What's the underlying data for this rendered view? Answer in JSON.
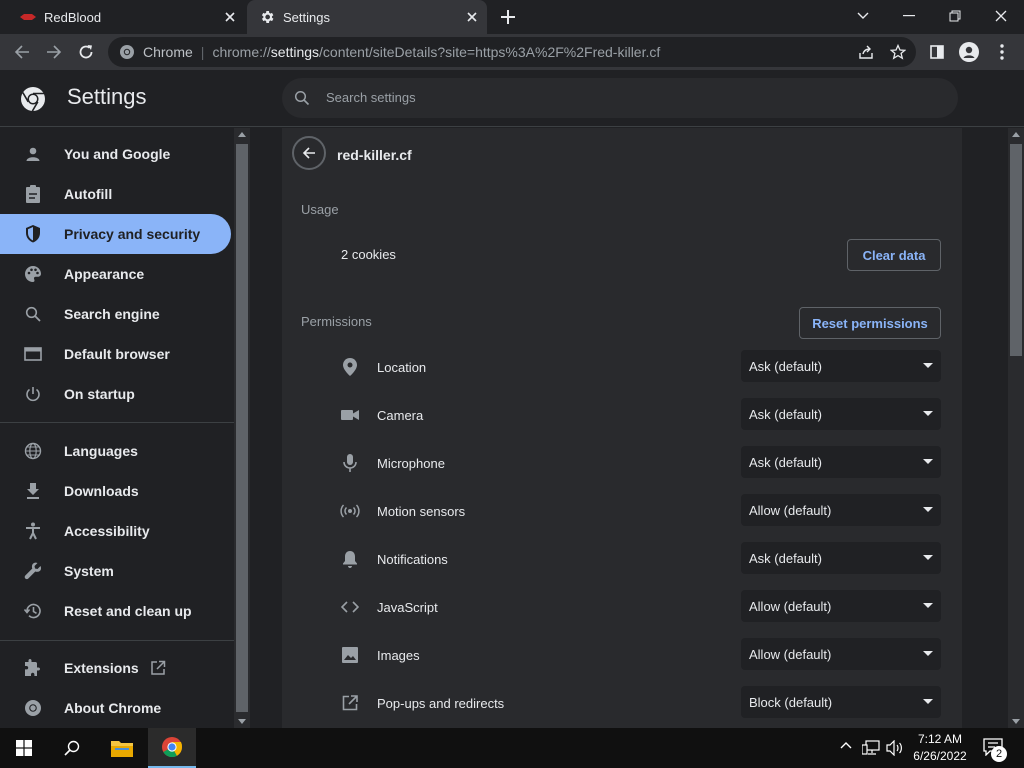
{
  "tabs": [
    {
      "title": "RedBlood",
      "icon": "redblood-favicon"
    },
    {
      "title": "Settings",
      "icon": "gear-icon"
    }
  ],
  "omnibox": {
    "chip": "Chrome",
    "url_prefix": "chrome://",
    "url_host": "settings",
    "url_rest": "/content/siteDetails?site=https%3A%2F%2Fred-killer.cf"
  },
  "header": {
    "title": "Settings",
    "search_placeholder": "Search settings"
  },
  "sidebar": {
    "items": [
      {
        "label": "You and Google",
        "icon": "person-icon"
      },
      {
        "label": "Autofill",
        "icon": "clipboard-icon"
      },
      {
        "label": "Privacy and security",
        "icon": "shield-icon",
        "active": true
      },
      {
        "label": "Appearance",
        "icon": "palette-icon"
      },
      {
        "label": "Search engine",
        "icon": "search-icon"
      },
      {
        "label": "Default browser",
        "icon": "browser-icon"
      },
      {
        "label": "On startup",
        "icon": "power-icon"
      },
      {
        "label": "Languages",
        "icon": "globe-icon"
      },
      {
        "label": "Downloads",
        "icon": "download-icon"
      },
      {
        "label": "Accessibility",
        "icon": "accessibility-icon"
      },
      {
        "label": "System",
        "icon": "wrench-icon"
      },
      {
        "label": "Reset and clean up",
        "icon": "history-icon"
      },
      {
        "label": "Extensions",
        "icon": "puzzle-icon"
      },
      {
        "label": "About Chrome",
        "icon": "chrome-icon"
      }
    ]
  },
  "site": {
    "name": "red-killer.cf",
    "usage_label": "Usage",
    "cookies": "2 cookies",
    "clear_data": "Clear data",
    "permissions_label": "Permissions",
    "reset_permissions": "Reset permissions"
  },
  "permissions": [
    {
      "label": "Location",
      "value": "Ask (default)",
      "icon": "location-pin-icon"
    },
    {
      "label": "Camera",
      "value": "Ask (default)",
      "icon": "camera-icon"
    },
    {
      "label": "Microphone",
      "value": "Ask (default)",
      "icon": "microphone-icon"
    },
    {
      "label": "Motion sensors",
      "value": "Allow (default)",
      "icon": "sensors-icon"
    },
    {
      "label": "Notifications",
      "value": "Ask (default)",
      "icon": "bell-icon"
    },
    {
      "label": "JavaScript",
      "value": "Allow (default)",
      "icon": "code-icon"
    },
    {
      "label": "Images",
      "value": "Allow (default)",
      "icon": "image-icon"
    },
    {
      "label": "Pop-ups and redirects",
      "value": "Block (default)",
      "icon": "open-in-new-icon"
    }
  ],
  "taskbar": {
    "time": "7:12 AM",
    "date": "6/26/2022",
    "notification_count": "2"
  },
  "colors": {
    "accent": "#8ab4f8",
    "background": "#202124",
    "card": "#292a2d"
  }
}
